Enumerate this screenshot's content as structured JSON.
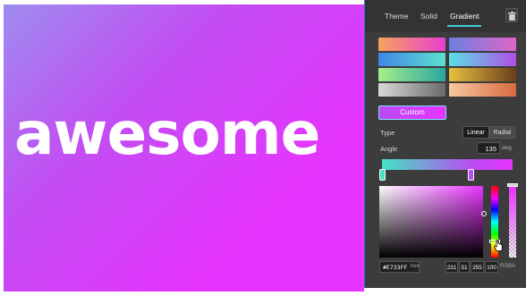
{
  "canvas": {
    "headline": "awesome",
    "background_colors": [
      "#9d8ff0",
      "#c24df2",
      "#e733ff"
    ]
  },
  "panel": {
    "tabs": [
      {
        "label": "Theme",
        "active": false
      },
      {
        "label": "Solid",
        "active": false
      },
      {
        "label": "Gradient",
        "active": true
      }
    ],
    "trash_icon": "trash-icon",
    "presets": [
      {
        "from": "#f6a25c",
        "to": "#e83fd2"
      },
      {
        "from": "#6c7fe0",
        "to": "#e066c8"
      },
      {
        "from": "#3f86e6",
        "to": "#5ee0d0"
      },
      {
        "from": "#5ae0e6",
        "to": "#b04ee6"
      },
      {
        "from": "#a6ef8a",
        "to": "#2aa6a0"
      },
      {
        "from": "#e8c040",
        "to": "#6a3f1c"
      },
      {
        "from": "#d9d9d9",
        "to": "#6a6a6a"
      },
      {
        "from": "#f6c8a2",
        "to": "#d96a3e"
      }
    ],
    "custom_label": "Custom",
    "type_label": "Type",
    "type_options": [
      "Linear",
      "Radial"
    ],
    "type_selected": "Linear",
    "angle_label": "Angle",
    "angle_value": "135",
    "angle_unit": "deg",
    "gradient_stops": [
      {
        "color": "#44e3c2",
        "position": 0.0
      },
      {
        "color": "#b94bf2",
        "position": 0.68
      }
    ],
    "picker": {
      "hex_value": "#E733FF",
      "hex_unit": "hex",
      "rgba": [
        "231",
        "51",
        "255",
        "100"
      ],
      "rgba_unit": "RGBA",
      "hue_marker_fraction": 0.79,
      "alpha_fraction": 1.0
    },
    "accent_color": "#44c7d6"
  }
}
